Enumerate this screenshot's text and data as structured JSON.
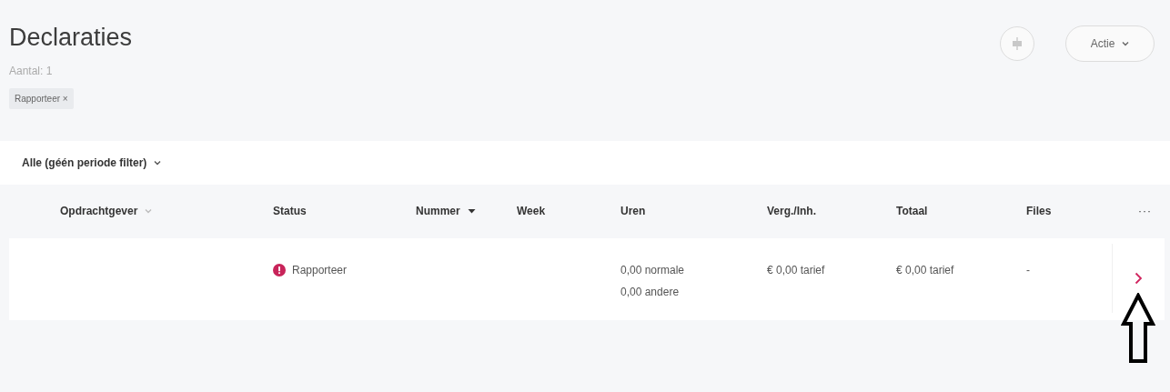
{
  "header": {
    "title": "Declaraties",
    "count": "Aantal: 1",
    "chips": [
      {
        "label": "Rapporteer ×"
      }
    ],
    "action_button": {
      "label": "Actie"
    }
  },
  "period_filter": {
    "label": "Alle (géén periode filter)"
  },
  "table": {
    "columns": [
      {
        "label": "Opdrachtgever",
        "sortable": true,
        "sorted": false
      },
      {
        "label": "Status",
        "sortable": false,
        "sorted": false
      },
      {
        "label": "Nummer",
        "sortable": true,
        "sorted": true
      },
      {
        "label": "Week",
        "sortable": false,
        "sorted": false
      },
      {
        "label": "Uren",
        "sortable": false,
        "sorted": false
      },
      {
        "label": "Verg./Inh.",
        "sortable": false,
        "sorted": false
      },
      {
        "label": "Totaal",
        "sortable": false,
        "sorted": false
      },
      {
        "label": "Files",
        "sortable": false,
        "sorted": false
      }
    ],
    "more": "···",
    "rows": [
      {
        "status": {
          "label": "Rapporteer",
          "color": "#c8245a"
        },
        "uren": [
          "0,00 normale",
          "0,00 andere"
        ],
        "verg": "€ 0,00 tarief",
        "totaal": "€ 0,00 tarief",
        "files": "-"
      }
    ]
  }
}
